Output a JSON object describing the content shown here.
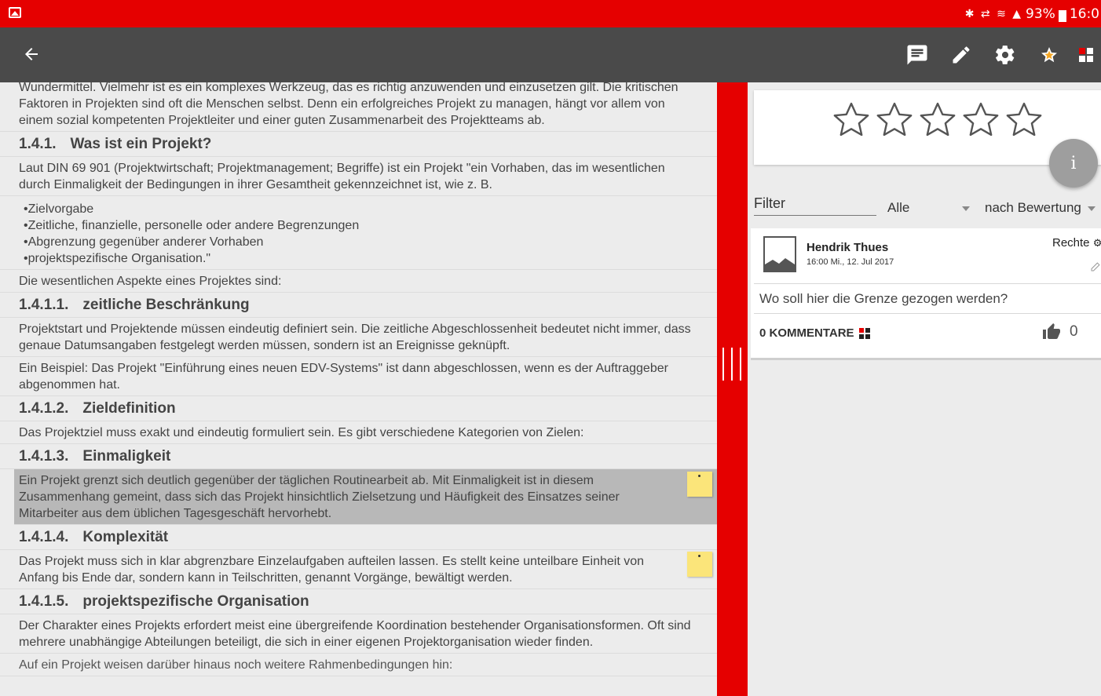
{
  "status_bar": {
    "icons": "✱ ⇄ ≋ ▲",
    "battery": "93%",
    "time": "16:0"
  },
  "toolbar": {
    "icons": [
      "back-arrow-icon",
      "comment-icon",
      "edit-icon",
      "settings-icon",
      "star-icon",
      "grid-icon"
    ]
  },
  "document": {
    "intro": "Wundermittel. Vielmehr ist es ein komplexes Werkzeug, das es richtig anzuwenden und einzusetzen gilt. Die kritischen Faktoren in Projekten sind oft die Menschen selbst. Denn ein erfolgreiches Projekt zu managen, hängt vor allem von einem sozial kompetenten Projektleiter und einer guten Zusammenarbeit des Projektteams ab.",
    "h_141_num": "1.4.1.",
    "h_141_title": "Was ist ein Projekt?",
    "p_141": "Laut DIN 69 901 (Projektwirtschaft; Projektmanagement; Begriffe) ist ein Projekt \"ein Vorhaben, das im wesentlichen durch Einmaligkeit der Bedingungen in ihrer Gesamtheit gekennzeichnet ist, wie z. B.",
    "list": [
      "•Zielvorgabe",
      "•Zeitliche, finanzielle, personelle oder andere Begrenzungen",
      "•Abgrenzung gegenüber anderer Vorhaben",
      "•projektspezifische Organisation.\""
    ],
    "p_aspects": "Die wesentlichen Aspekte eines Projektes sind:",
    "h_1411_num": "1.4.1.1.",
    "h_1411_title": "zeitliche Beschränkung",
    "p_1411a": "Projektstart und Projektende müssen eindeutig definiert sein. Die zeitliche Abgeschlossenheit bedeutet nicht immer, dass genaue Datumsangaben festgelegt werden müssen, sondern ist an Ereignisse geknüpft.",
    "p_1411b": "Ein Beispiel: Das Projekt \"Einführung eines neuen EDV-Systems\" ist dann abgeschlossen, wenn es der Auftraggeber abgenommen hat.",
    "h_1412_num": "1.4.1.2.",
    "h_1412_title": "Zieldefinition",
    "p_1412": "Das Projektziel muss exakt und eindeutig formuliert sein. Es gibt verschiedene Kategorien von Zielen:",
    "h_1413_num": "1.4.1.3.",
    "h_1413_title": "Einmaligkeit",
    "p_1413": "Ein Projekt grenzt sich deutlich gegenüber der täglichen Routinearbeit ab. Mit Einmaligkeit ist in diesem Zusammenhang gemeint, dass sich das Projekt hinsichtlich Zielsetzung und Häufigkeit des Einsatzes seiner Mitarbeiter aus dem üblichen Tagesgeschäft hervorhebt.",
    "h_1414_num": "1.4.1.4.",
    "h_1414_title": "Komplexität",
    "p_1414": "Das Projekt muss sich in klar abgrenzbare Einzelaufgaben aufteilen lassen. Es stellt keine unteilbare Einheit von Anfang bis Ende dar, sondern kann in Teilschritten, genannt Vorgänge, bewältigt werden.",
    "h_1415_num": "1.4.1.5.",
    "h_1415_title": "projektspezifische Organisation",
    "p_1415": "Der Charakter eines Projekts erfordert meist eine übergreifende Koordination bestehender Organisationsformen. Oft sind mehrere unabhängige Abteilungen beteiligt, die sich in einer eigenen Projektorganisation wieder finden.",
    "p_cut": "Auf ein Projekt weisen darüber hinaus noch weitere Rahmenbedingungen hin:"
  },
  "rating": {
    "stars_filled": 0,
    "stars_total": 5,
    "info_label": "i"
  },
  "filter": {
    "label": "Filter",
    "scope": "Alle",
    "sort": "nach Bewertung"
  },
  "post": {
    "author": "Hendrik Thues",
    "date": "16:00 Mi., 12. Jul 2017",
    "rights": "Rechte",
    "question": "Wo soll hier die Grenze gezogen werden?",
    "comments": "0 KOMMENTARE",
    "likes": "0"
  },
  "colors": {
    "accent": "#e50000",
    "toolbar": "#4a4a4a",
    "highlight": "#b8b8b8",
    "note": "#fbe57a"
  }
}
